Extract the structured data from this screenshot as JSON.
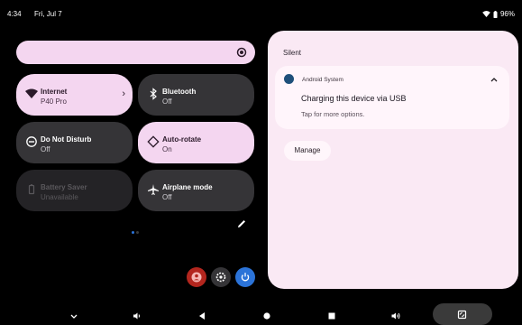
{
  "status_bar": {
    "time": "4:34",
    "date": "Fri, Jul 7",
    "battery": "96%"
  },
  "quick_settings": {
    "brightness": {
      "level": 1.0
    },
    "tiles": [
      {
        "title": "Internet",
        "subtitle": "P40 Pro",
        "icon": "wifi-icon",
        "state": "on"
      },
      {
        "title": "Bluetooth",
        "subtitle": "Off",
        "icon": "bluetooth-icon",
        "state": "off"
      },
      {
        "title": "Do Not Disturb",
        "subtitle": "Off",
        "icon": "do-not-disturb-icon",
        "state": "off"
      },
      {
        "title": "Auto-rotate",
        "subtitle": "On",
        "icon": "auto-rotate-icon",
        "state": "on"
      },
      {
        "title": "Battery Saver",
        "subtitle": "Unavailable",
        "icon": "battery-saver-icon",
        "state": "disabled"
      },
      {
        "title": "Airplane mode",
        "subtitle": "Off",
        "icon": "airplane-icon",
        "state": "off"
      }
    ],
    "page_count": 2,
    "current_page": 1
  },
  "notifications": {
    "section_label": "Silent",
    "items": [
      {
        "app_name": "Android System",
        "title": "Charging this device via USB",
        "text": "Tap for more options."
      }
    ],
    "manage_label": "Manage"
  },
  "colors": {
    "tile_on": "#f4d6f0",
    "tile_off": "#353437",
    "accent_blue": "#2b73d8",
    "user_red": "#b3261e"
  }
}
